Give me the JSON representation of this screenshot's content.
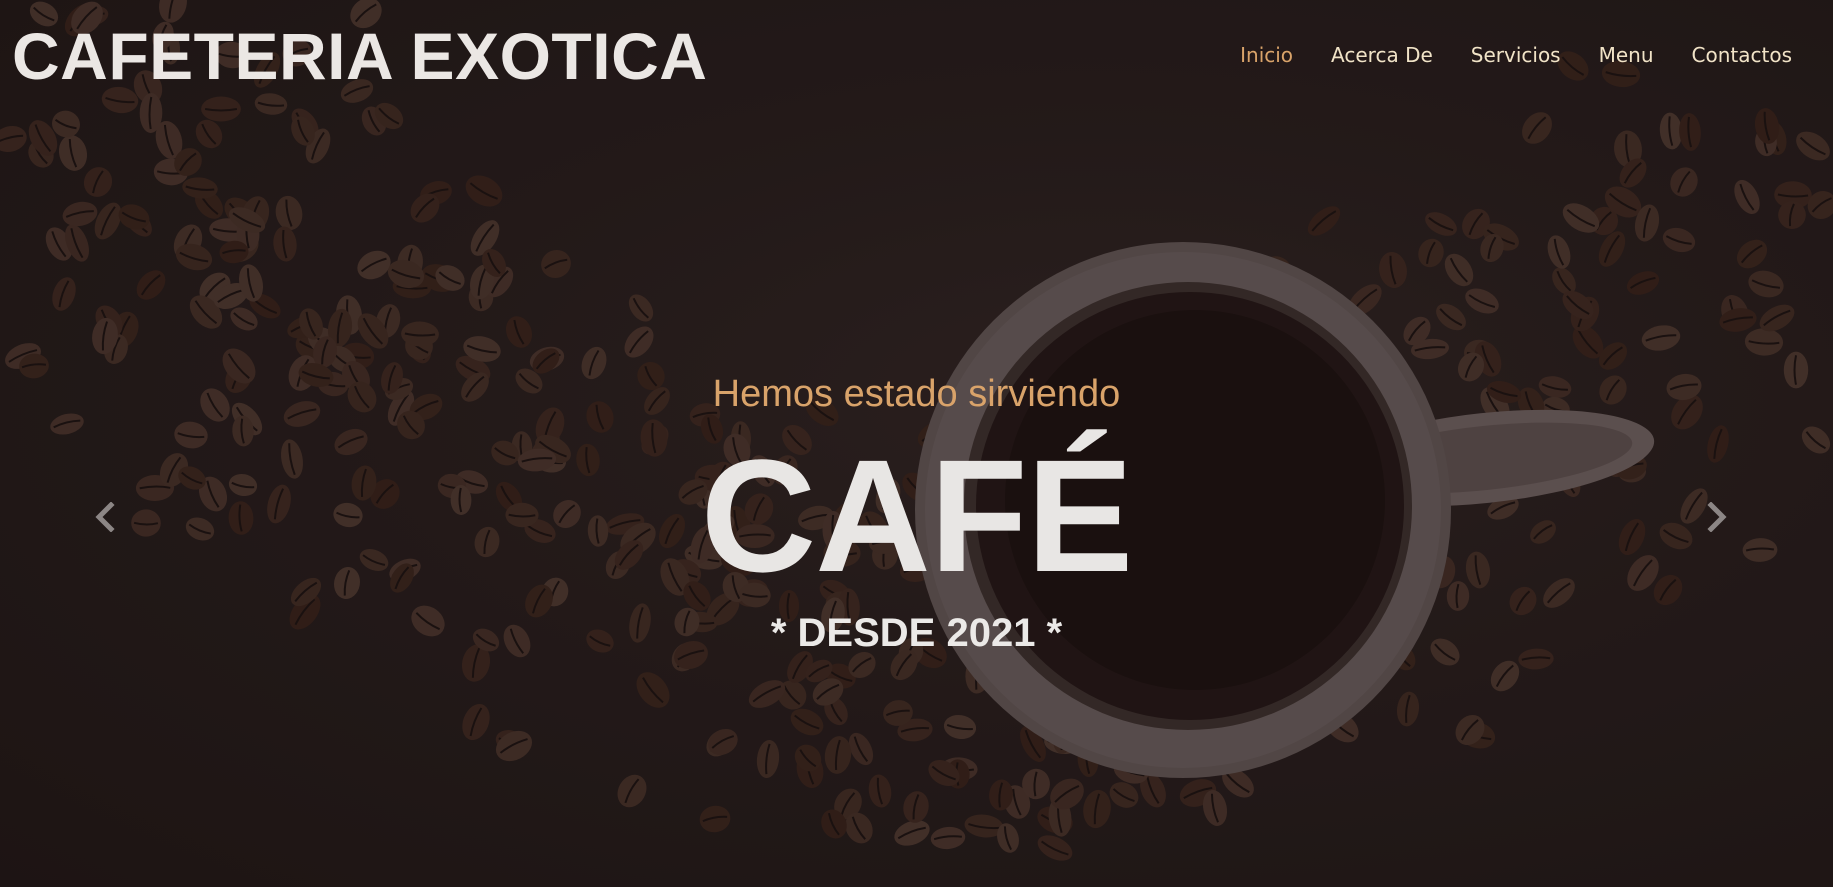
{
  "brand": {
    "name": "CAFETERIA EXOTICA"
  },
  "nav": {
    "items": [
      {
        "label": "Inicio",
        "active": true
      },
      {
        "label": "Acerca De",
        "active": false
      },
      {
        "label": "Servicios",
        "active": false
      },
      {
        "label": "Menu",
        "active": false
      },
      {
        "label": "Contactos",
        "active": false
      }
    ]
  },
  "hero": {
    "subtitle": "Hemos estado sirviendo",
    "title": "CAFÉ",
    "since": "* DESDE 2021 *"
  },
  "carousel": {
    "prev_icon": "chevron-left-icon",
    "next_icon": "chevron-right-icon"
  },
  "colors": {
    "background": "#221a19",
    "accent": "#d9a36a",
    "nav_text": "#f1e3c7",
    "title_text": "#e8e6e4"
  }
}
